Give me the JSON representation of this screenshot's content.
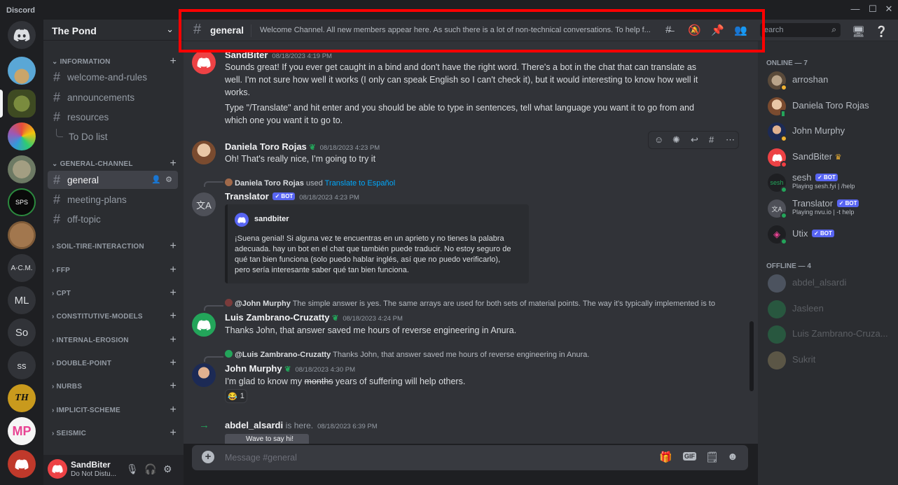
{
  "window": {
    "app_name": "Discord"
  },
  "rail": {
    "servers": [
      "",
      "",
      "",
      "",
      "",
      "",
      "",
      "A-C.M.",
      "ML",
      "So",
      "ss",
      "TH",
      "MP",
      ""
    ],
    "sps_label": "SPS"
  },
  "guild": {
    "name": "The Pond"
  },
  "categories": [
    {
      "label": "INFORMATION"
    },
    {
      "label": "GENERAL-CHANNEL"
    },
    {
      "label": "SOIL-TIRE-INTERACTION"
    },
    {
      "label": "FFP"
    },
    {
      "label": "CPT"
    },
    {
      "label": "CONSTITUTIVE-MODELS"
    },
    {
      "label": "INTERNAL-EROSION"
    },
    {
      "label": "DOUBLE-POINT"
    },
    {
      "label": "NURBS"
    },
    {
      "label": "IMPLICIT-SCHEME"
    },
    {
      "label": "SEISMIC"
    }
  ],
  "channels": {
    "welcome": "welcome-and-rules",
    "announcements": "announcements",
    "resources": "resources",
    "todo": "To Do list",
    "general": "general",
    "meeting": "meeting-plans",
    "offtopic": "off-topic"
  },
  "user": {
    "name": "SandBiter",
    "status": "Do Not Distu..."
  },
  "header": {
    "channel": "general",
    "topic": "Welcome Channel. All new members appear here. As such there is a lot of non-technical conversations. To help f...",
    "search_placeholder": "earch"
  },
  "messages": {
    "m1": {
      "author": "SandBiter",
      "time": "08/18/2023 4:19 PM",
      "p1": "Sounds great! If you ever get caught in a bind and don't have the right word. There's a bot in the chat that can translate as well. I'm not sure how well it works (I only can speak English so I can't check it), but it would interesting to know how well it works.",
      "p2": "Type \"/Translate\" and hit enter and you should be able to type in sentences, tell what language you want it to go from and which one you want it to go to."
    },
    "m2": {
      "author": "Daniela Toro Rojas",
      "time": "08/18/2023 4:23 PM",
      "text": "Oh! That's really nice, I'm going to try it"
    },
    "m3": {
      "reply_user": "Daniela Toro Rojas",
      "reply_used": "used",
      "reply_cmd": "Translate to Español",
      "author": "Translator",
      "bot_tag": "✓ BOT",
      "time": "08/18/2023 4:23 PM",
      "embed_author": "sandbiter",
      "embed_text": "¡Suena genial! Si alguna vez te encuentras en un aprieto y no tienes la palabra adecuada. hay un bot en el chat que también puede traducir. No estoy seguro de qué tan bien funciona (solo puedo hablar inglés, así que no puedo verificarlo), pero sería interesante saber qué tan bien funciona."
    },
    "m4": {
      "reply_user": "@John Murphy",
      "reply_text": "The simple answer is yes. The same arrays are used for both sets of material points. The way it's typically implemented is to",
      "author": "Luis Zambrano-Cruzatty",
      "time": "08/18/2023 4:24 PM",
      "text": "Thanks John, that answer saved me hours of reverse engineering in Anura."
    },
    "m5": {
      "reply_user": "@Luis Zambrano-Cruzatty",
      "reply_text": "Thanks John, that answer saved me hours of reverse engineering in Anura.",
      "author": "John Murphy",
      "time": "08/18/2023 4:30 PM",
      "text_pre": "I'm glad to know my ",
      "text_strike": "months",
      "text_post": " years of suffering will help others.",
      "reaction_emoji": "😂",
      "reaction_count": "1"
    },
    "m6": {
      "author": "abdel_alsardi",
      "suffix": "is here.",
      "time": "08/18/2023 6:39 PM",
      "button": "Wave to say hi!"
    }
  },
  "composer": {
    "placeholder": "Message #general",
    "gif": "GIF"
  },
  "members": {
    "online_header": "ONLINE — 7",
    "offline_header": "OFFLINE — 4",
    "online": [
      {
        "name": "arroshan"
      },
      {
        "name": "Daniela Toro Rojas"
      },
      {
        "name": "John Murphy"
      },
      {
        "name": "SandBiter"
      },
      {
        "name": "sesh",
        "bot": "✓ BOT",
        "activity": "Playing sesh.fyi | /help"
      },
      {
        "name": "Translator",
        "bot": "✓ BOT",
        "activity": "Playing nvu.io | -t help"
      },
      {
        "name": "Utix",
        "bot": "✓ BOT"
      }
    ],
    "offline": [
      {
        "name": "abdel_alsardi"
      },
      {
        "name": "Jasleen"
      },
      {
        "name": "Luis Zambrano-Cruza..."
      },
      {
        "name": "Sukrit"
      }
    ]
  },
  "colors": {
    "accent": "#5865f2",
    "highlight_box": "#ff0000",
    "online": "#23a55a",
    "dnd": "#f23f43",
    "idle": "#f0b232"
  }
}
